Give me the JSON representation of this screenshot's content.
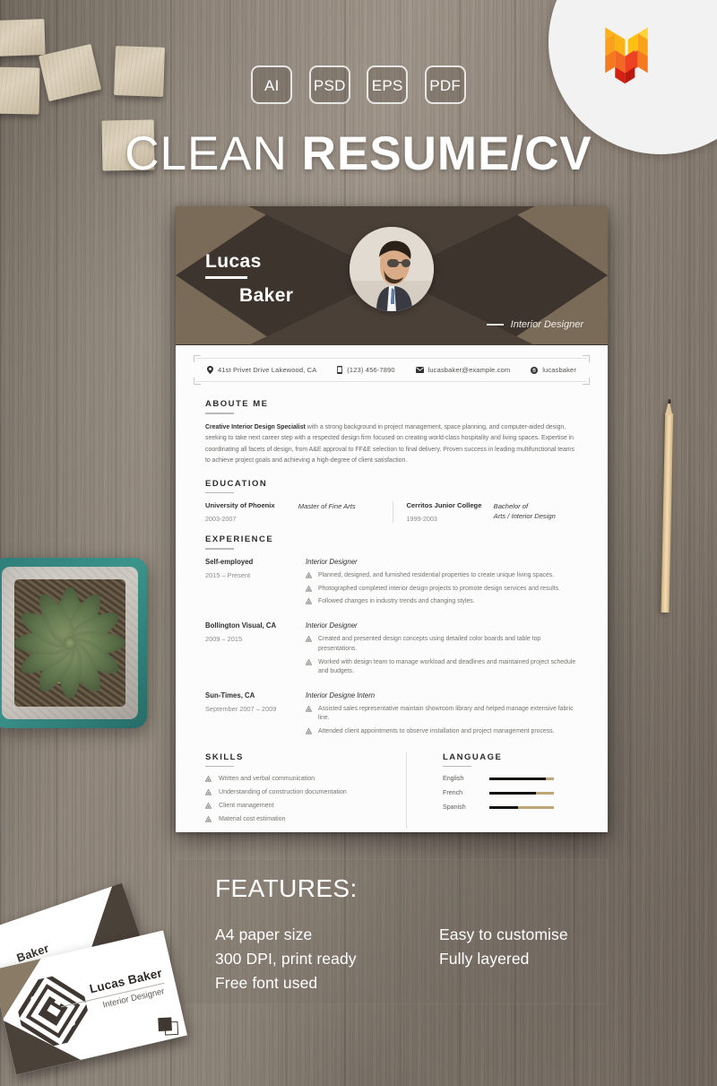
{
  "promo": {
    "formats": [
      "AI",
      "PSD",
      "EPS",
      "PDF"
    ],
    "title_thin": "CLEAN",
    "title_bold": "RESUME/CV",
    "logo_name": "templatemonster-heart-logo"
  },
  "resume": {
    "first_name": "Lucas",
    "last_name": "Baker",
    "role": "Interior Designer",
    "avatar_alt": "profile-photo-man-sunglasses-suit",
    "contact": [
      {
        "icon": "location-pin-icon",
        "value": "41st Privet Drive Lakewood, CA"
      },
      {
        "icon": "phone-icon",
        "value": "(123) 456-7890"
      },
      {
        "icon": "envelope-icon",
        "value": "lucasbaker@example.com"
      },
      {
        "icon": "skype-icon",
        "value": "lucasbaker"
      }
    ],
    "about": {
      "heading": "ABOUTE ME",
      "lead": "Creative Interior Design Specialist",
      "text": " with a strong background in project management, space planning, and computer-aided design, seeking to take next career step with a respected design firm focused on creating world-class hospitality and living spaces. Expertise in coordinating all facets of design, from A&E approval to FF&E selection to final delivery. Proven success in leading multifunctional teams to achieve project goals and achieving a high-degree of client satisfaction."
    },
    "education": {
      "heading": "EDUCATION",
      "items": [
        {
          "school": "University of Phoenix",
          "years": "2003-2007",
          "degree": "Master of Fine Arts"
        },
        {
          "school": "Cerritos Junior College",
          "years": "1999-2003",
          "degree": "Bachelor of\nArts / Interior Design"
        }
      ]
    },
    "experience": {
      "heading": "EXPERIENCE",
      "jobs": [
        {
          "company": "Self-employed",
          "dates": "2015 – Present",
          "title": "Interior Designer",
          "bullets": [
            "Planned, designed, and furnished residential properties to create unique living spaces.",
            "Photographed completed interior design projects to promote design services and results.",
            "Followed changes in industry trends and changing styles."
          ]
        },
        {
          "company": "Bollington Visual, CA",
          "dates": "2009 – 2015",
          "title": "Interior Designer",
          "bullets": [
            "Created and presented design concepts using detailed color boards and table top presentations.",
            "Worked with design team to manage workload and deadlines and maintained project schedule and budgets."
          ]
        },
        {
          "company": "Sun-Times, CA",
          "dates": "September 2007 – 2009",
          "title": "Interior Designe Intern",
          "bullets": [
            "Assisted sales representative maintain showroom library and helped manage extensive fabric line.",
            "Attended client appointments to observe installation and project management process."
          ]
        }
      ]
    },
    "skills": {
      "heading": "SKILLS",
      "items": [
        "Written and verbal communication",
        "Understanding of construction documentation",
        "Client management",
        "Material cost estimation"
      ]
    },
    "language": {
      "heading": "LANGUAGE",
      "items": [
        {
          "name": "English",
          "level": 88
        },
        {
          "name": "French",
          "level": 72
        },
        {
          "name": "Spanish",
          "level": 45
        }
      ]
    }
  },
  "features": {
    "title": "FEATURES:",
    "column_left": [
      "A4 paper size",
      "300 DPI, print ready",
      "Free font used"
    ],
    "column_right": [
      "Easy to customise",
      "Fully layered"
    ]
  },
  "business_card": {
    "name": "Lucas Baker",
    "role": "Interior Designer",
    "back_name": "Baker"
  },
  "colors": {
    "header_dark": "#3d342d",
    "header_mid": "#4a4038",
    "header_light": "#7a6a58",
    "paper": "#fcfcfc",
    "bar_filled": "#151413",
    "bar_track": "#c0a579",
    "logo_orange": "#f47920",
    "logo_yellow": "#fdb913",
    "logo_red": "#d32011"
  }
}
